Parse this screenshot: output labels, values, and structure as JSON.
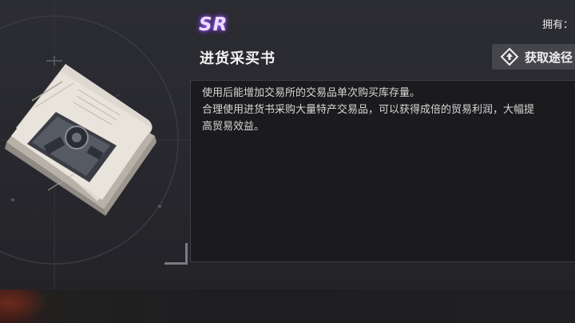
{
  "item": {
    "rarity": "SR",
    "name": "进货采买书",
    "owned_label": "拥有：",
    "description": [
      "使用后能增加交易所的交易品单次购买库存量。",
      "合理使用进货书采购大量特产交易品，可以获得成倍的贸易利润，大幅提",
      "高贸易效益。"
    ]
  },
  "actions": {
    "acquire_label": "获取途径"
  },
  "colors": {
    "rarity_glow": "#a35cff",
    "panel_bg": "#2a2a30",
    "desc_bg": "#1b1b1e"
  },
  "icons": {
    "acquire": "diamond-arrow-icon",
    "item": "book-icon"
  }
}
